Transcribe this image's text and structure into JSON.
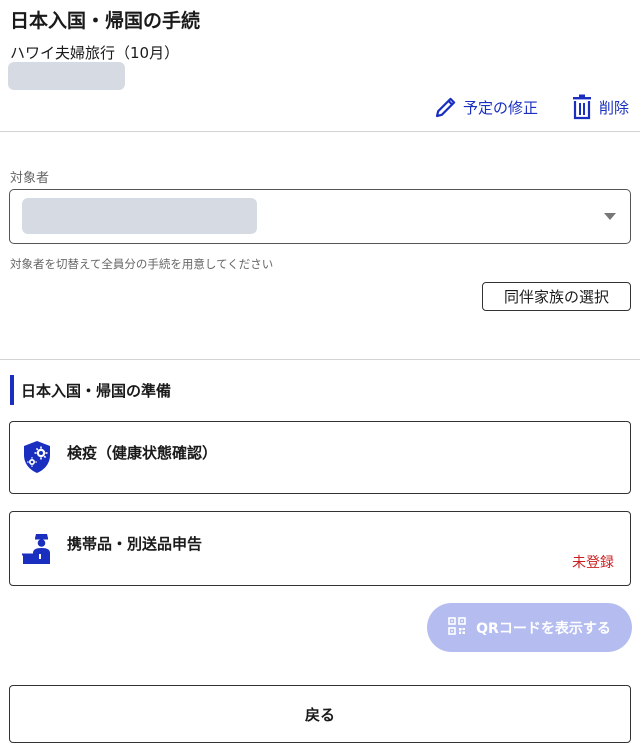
{
  "header": {
    "title": "日本入国・帰国の手続",
    "trip_name": "ハワイ夫婦旅行（10月）"
  },
  "actions": {
    "edit_label": "予定の修正",
    "delete_label": "削除"
  },
  "target_person": {
    "label": "対象者",
    "hint": "対象者を切替えて全員分の手続を用意してください"
  },
  "family_button_label": "同伴家族の選択",
  "section": {
    "title": "日本入国・帰国の準備",
    "cards": [
      {
        "title": "検疫（健康状態確認）",
        "icon": "virus-shield-icon"
      },
      {
        "title": "携帯品・別送品申告",
        "icon": "customs-officer-icon",
        "status": "未登録"
      }
    ]
  },
  "qr_button_label": "QRコードを表示する",
  "back_button_label": "戻る",
  "colors": {
    "accent": "#1a2fbf",
    "status_red": "#cc1f1f",
    "qr_disabled": "#b4bcf0"
  }
}
